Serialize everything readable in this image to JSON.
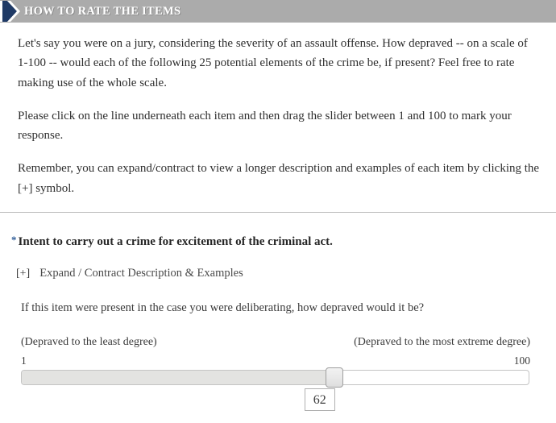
{
  "header": {
    "title": "HOW TO RATE THE ITEMS",
    "arrow_icon": "chevron-right-icon",
    "bar_color": "#ababab",
    "arrow_color": "#1f3a66",
    "title_color": "#ffffff"
  },
  "intro": {
    "paragraphs": [
      "Let's say you were on a jury, considering the severity of an assault offense. How depraved -- on a scale of 1-100 -- would each of the following 25 potential elements of the crime be, if present? Feel free to rate making use of the whole scale.",
      "Please click on the line underneath each item and then drag the slider between 1 and 100 to mark your response.",
      "Remember, you can expand/contract to view a longer description and examples of each item by clicking the [+] symbol."
    ]
  },
  "item": {
    "required_marker": "*",
    "required_marker_color": "#2e5c97",
    "title": "Intent to carry out a crime for excitement of the criminal act.",
    "expander_symbol": "[+]",
    "expander_label": "Expand / Contract Description & Examples",
    "question": "If this item were present in the case you were deliberating, how depraved would it be?"
  },
  "slider": {
    "anchor_left": "(Depraved to the least degree)",
    "anchor_right": "(Depraved to the most extreme degree)",
    "min_label": "1",
    "max_label": "100",
    "min": 1,
    "max": 100,
    "value": 62,
    "value_display": "62",
    "fill_percent": "62%",
    "fill_color": "#e3e3e1",
    "track_color": "#ffffff",
    "handle_color": "#eaeaea"
  }
}
